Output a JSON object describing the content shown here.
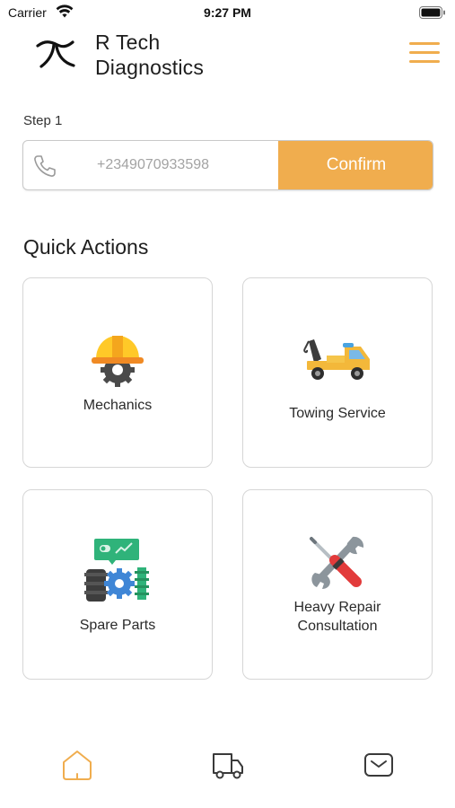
{
  "status_bar": {
    "carrier": "Carrier",
    "time": "9:27 PM"
  },
  "header": {
    "brand_line1": "R Tech",
    "brand_line2": "Diagnostics",
    "logo_icon": "r-tech-logo-icon",
    "menu_icon": "hamburger-menu-icon"
  },
  "step": {
    "label": "Step 1",
    "phone_placeholder": "+2349070933598",
    "confirm_label": "Confirm"
  },
  "quick_actions": {
    "title": "Quick Actions",
    "items": [
      {
        "label": "Mechanics",
        "icon": "hard-hat-gear-icon"
      },
      {
        "label": "Towing Service",
        "icon": "tow-truck-icon"
      },
      {
        "label": "Spare Parts",
        "icon": "spare-parts-gears-icon"
      },
      {
        "label_line1": "Heavy Repair",
        "label_line2": "Consultation",
        "icon": "wrench-screwdriver-icon"
      }
    ]
  },
  "tab_bar": {
    "items": [
      {
        "name": "home",
        "icon": "home-icon",
        "active": true
      },
      {
        "name": "delivery",
        "icon": "truck-icon",
        "active": false
      },
      {
        "name": "messages",
        "icon": "mail-icon",
        "active": false
      }
    ]
  },
  "colors": {
    "accent": "#f0ad4e",
    "border": "#d6d6d6",
    "text": "#222222",
    "tab_inactive": "#3a3a3a"
  }
}
